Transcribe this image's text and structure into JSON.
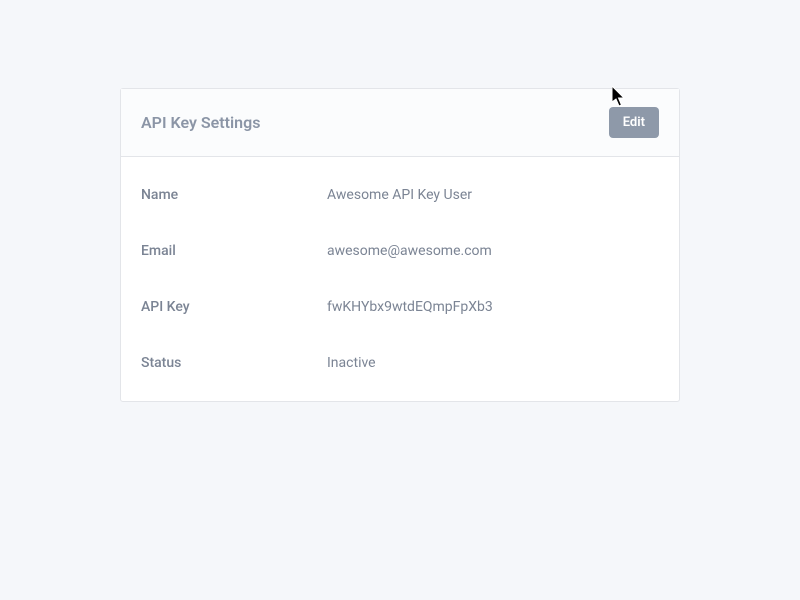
{
  "panel": {
    "title": "API Key Settings",
    "edit_label": "Edit",
    "fields": {
      "name": {
        "label": "Name",
        "value": "Awesome API Key User"
      },
      "email": {
        "label": "Email",
        "value": "awesome@awesome.com"
      },
      "api_key": {
        "label": "API Key",
        "value": "fwKHYbx9wtdEQmpFpXb3"
      },
      "status": {
        "label": "Status",
        "value": "Inactive"
      }
    }
  }
}
